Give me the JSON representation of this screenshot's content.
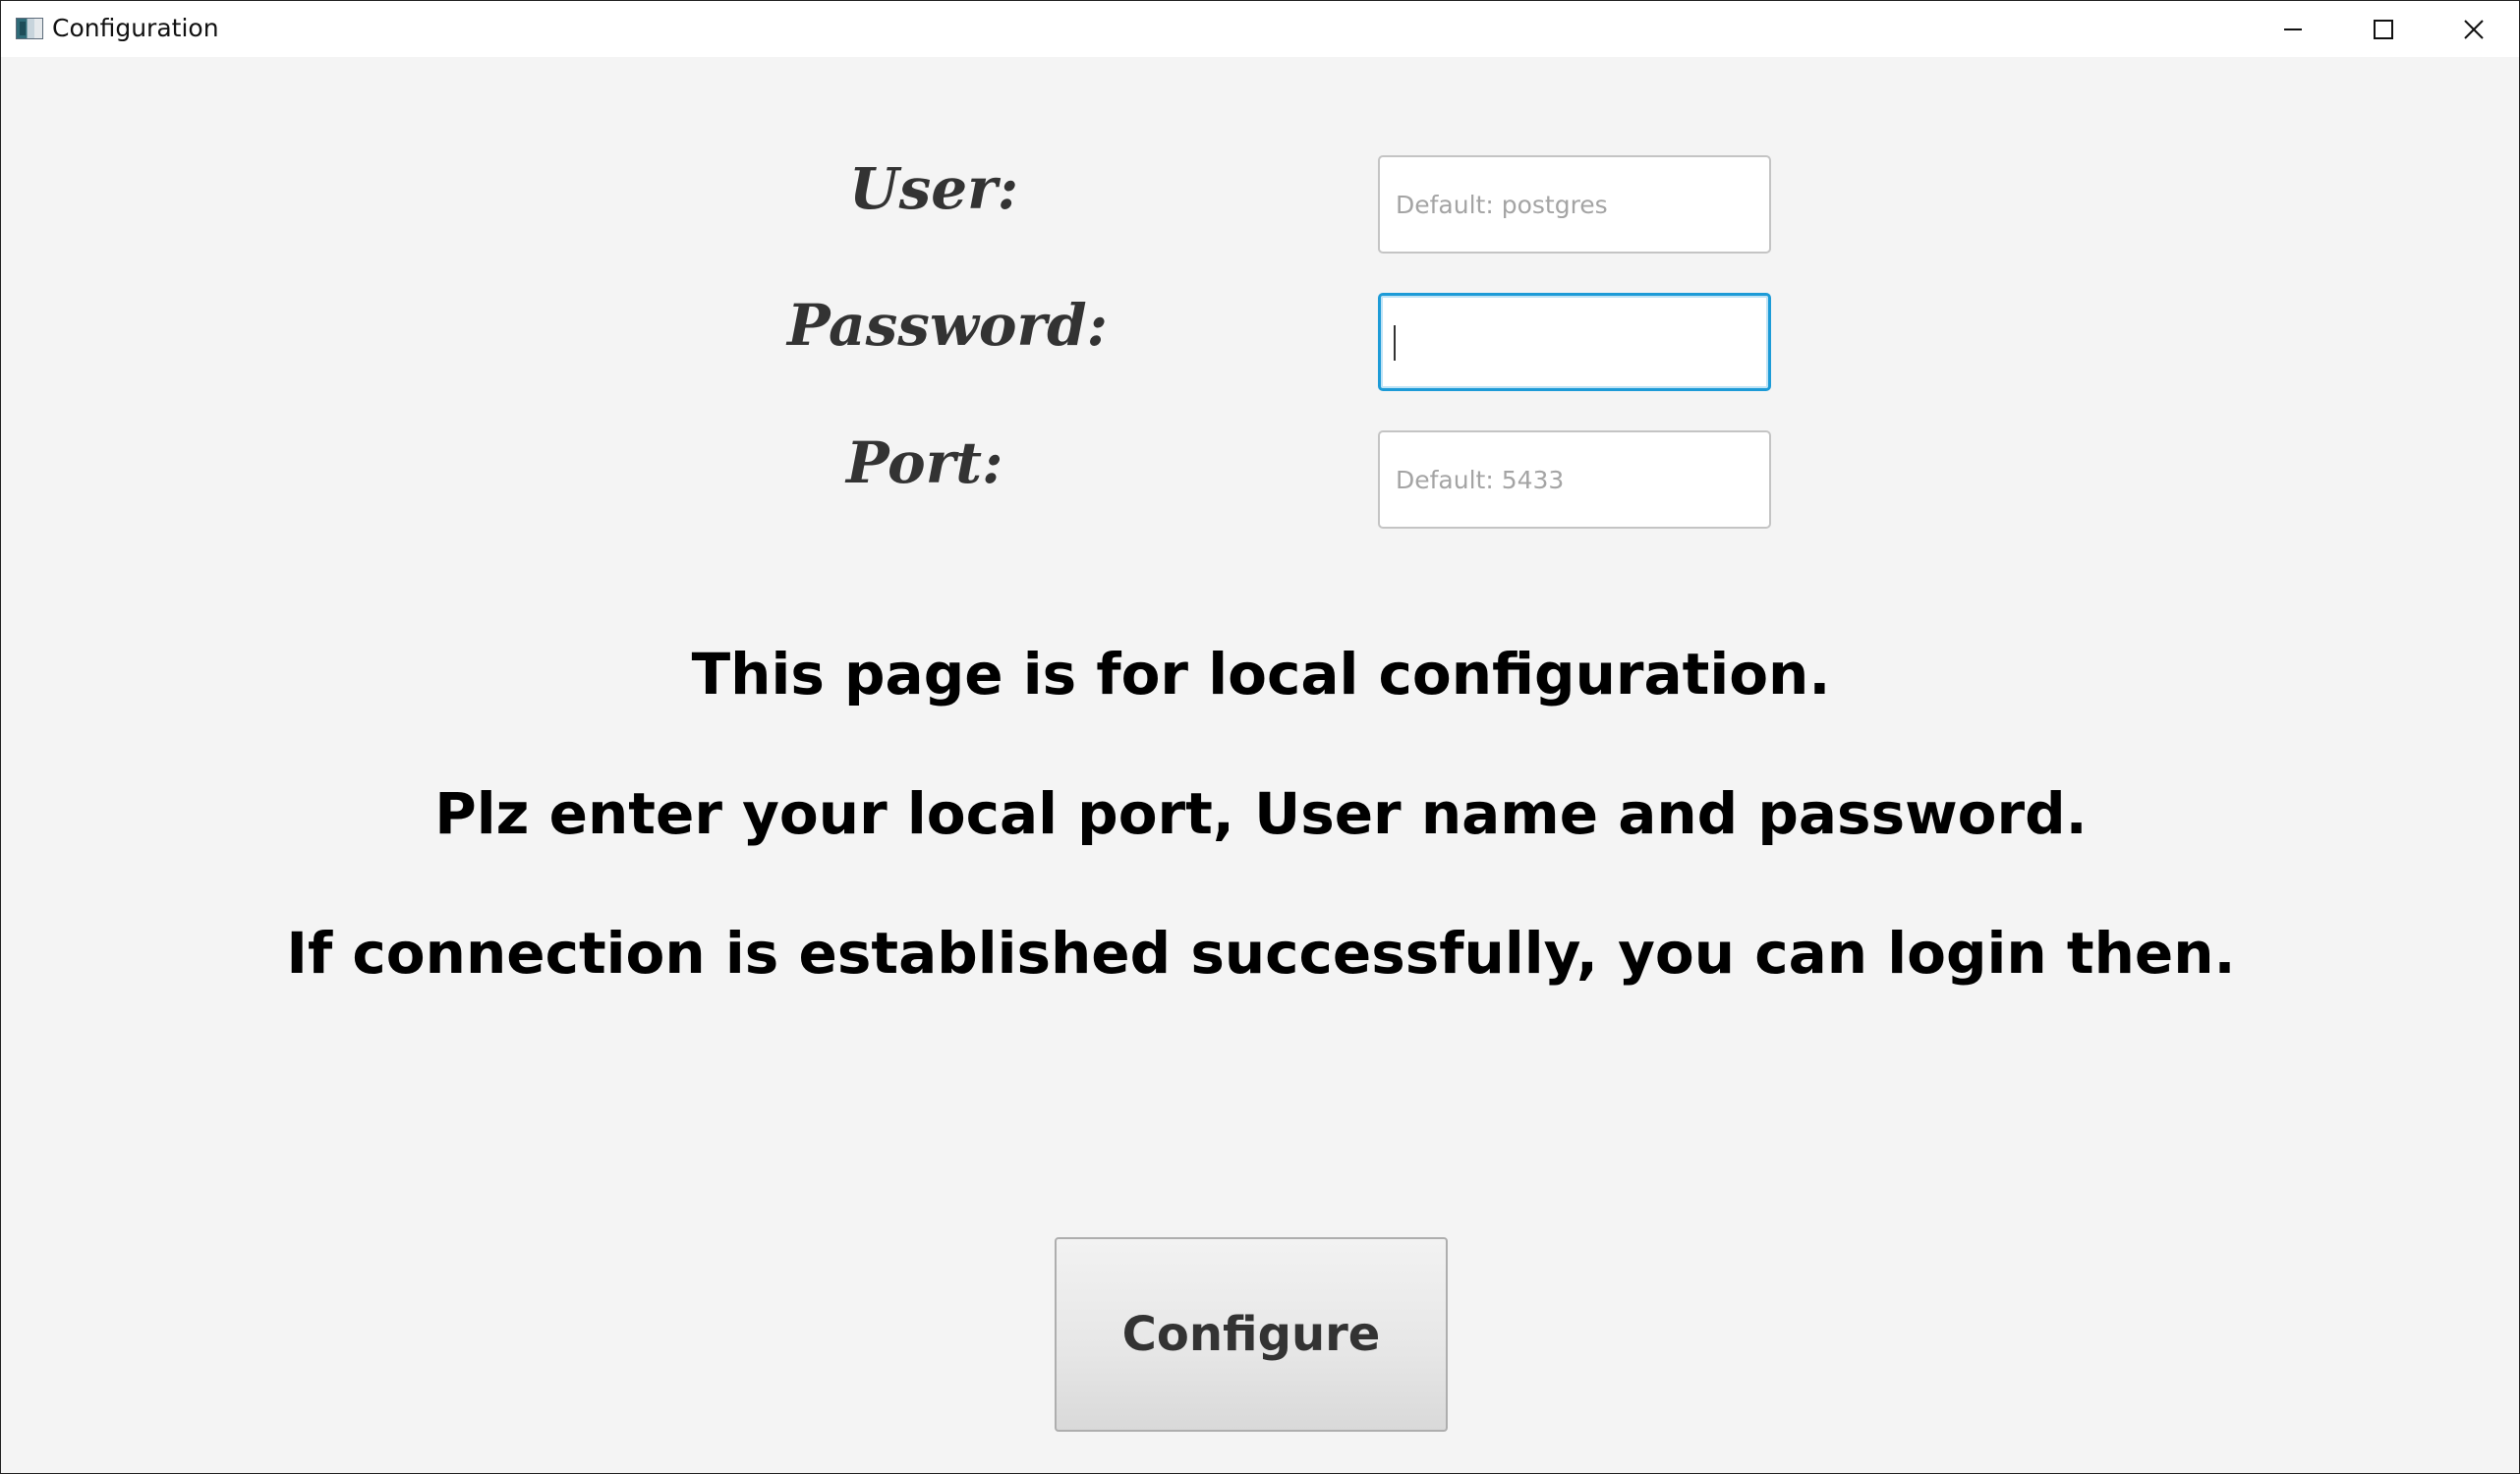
{
  "window": {
    "title": "Configuration",
    "controls": {
      "minimize": "minimize-icon",
      "maximize": "maximize-icon",
      "close": "close-icon"
    }
  },
  "form": {
    "user": {
      "label": "User:",
      "placeholder": "Default: postgres",
      "value": ""
    },
    "password": {
      "label": "Password:",
      "placeholder": "",
      "value": ""
    },
    "port": {
      "label": "Port:",
      "placeholder": "Default: 5433",
      "value": ""
    }
  },
  "info": {
    "line1": "This page is for local configuration.",
    "line2": "Plz enter your local port, User name and password.",
    "line3": "If connection is established successfully, you can login then."
  },
  "actions": {
    "configure_label": "Configure"
  },
  "colors": {
    "focus_border": "#1d9bd7",
    "background": "#f4f4f4"
  }
}
